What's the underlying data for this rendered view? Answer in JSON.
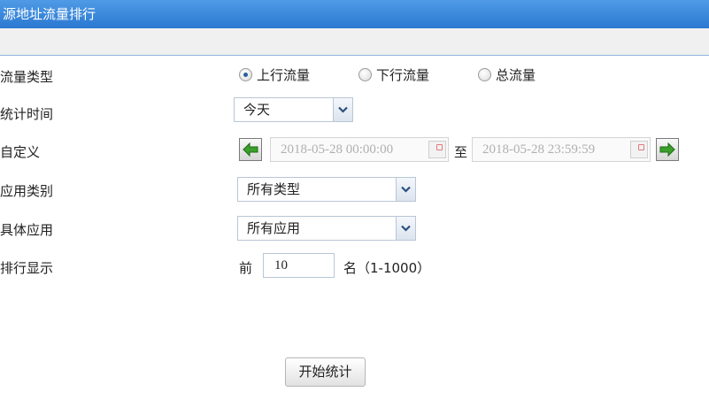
{
  "window": {
    "title": "源地址流量排行"
  },
  "form": {
    "traffic_type": {
      "label": "流量类型",
      "options": [
        {
          "label": "上行流量",
          "checked": true
        },
        {
          "label": "下行流量",
          "checked": false
        },
        {
          "label": "总流量",
          "checked": false
        }
      ]
    },
    "stat_time": {
      "label": "统计时间",
      "value": "今天"
    },
    "custom": {
      "label": "自定义",
      "start": "2018-05-28 00:00:00",
      "separator": "至",
      "end": "2018-05-28 23:59:59"
    },
    "app_category": {
      "label": "应用类别",
      "value": "所有类型"
    },
    "app": {
      "label": "具体应用",
      "value": "所有应用"
    },
    "rank": {
      "label": "排行显示",
      "prefix": "前",
      "value": "10",
      "suffix": "名（1-1000）"
    }
  },
  "actions": {
    "start_label": "开始统计"
  },
  "colors": {
    "titlebar": "#2a78d1",
    "accent": "#2a5d9a",
    "arrow_green": "#3aa02a"
  }
}
